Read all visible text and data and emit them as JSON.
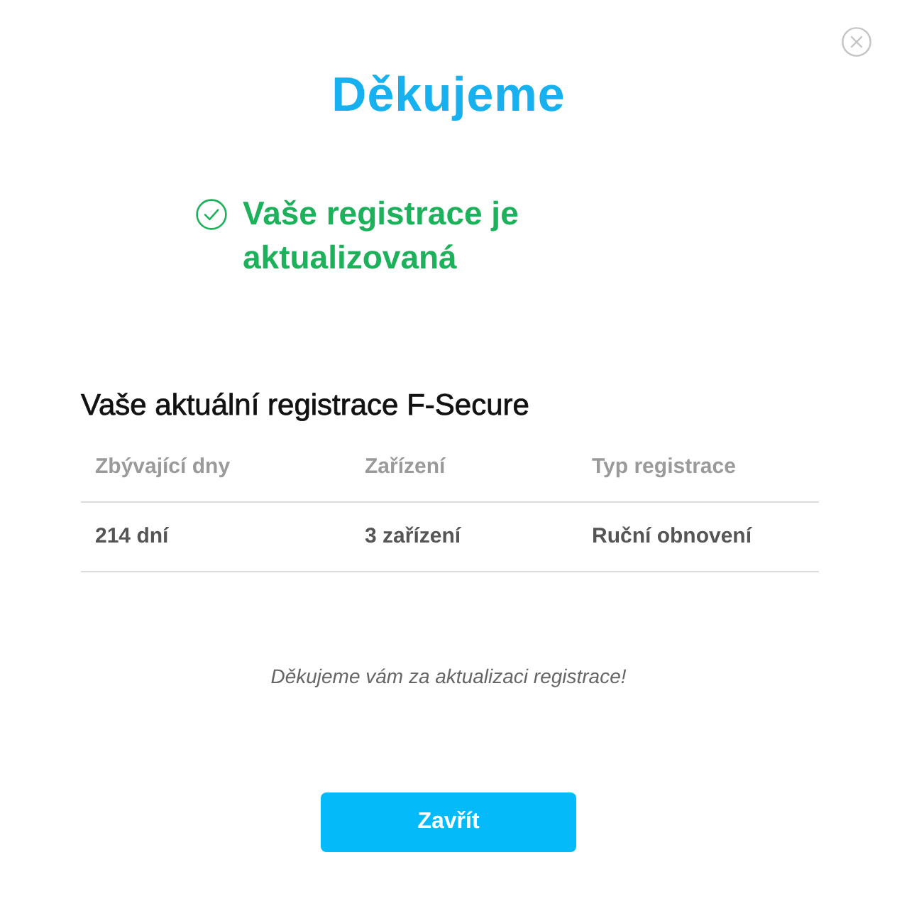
{
  "title": "Děkujeme",
  "status": {
    "text": "Vaše registrace je aktualizovaná"
  },
  "registration": {
    "heading": "Vaše aktuální registrace F-Secure",
    "table": {
      "columns": [
        "Zbývající dny",
        "Zařízení",
        "Typ registrace"
      ],
      "rows": [
        [
          "214 dní",
          "3 zařízení",
          "Ruční obnovení"
        ]
      ]
    }
  },
  "note": "Děkujeme vám za aktualizaci registrace!",
  "buttons": [
    "Zavřít"
  ]
}
